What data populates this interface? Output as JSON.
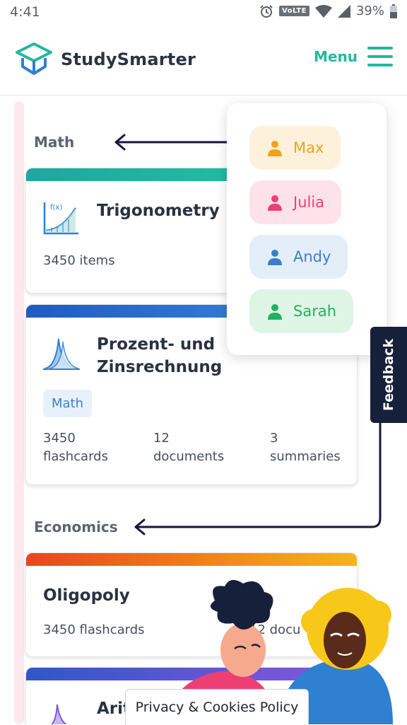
{
  "status_bar": {
    "time": "4:41",
    "volte": "VoLTE",
    "battery": "39%"
  },
  "header": {
    "brand": "StudySmarter",
    "menu_label": "Menu",
    "accent_color": "#22b8a0"
  },
  "sections": {
    "math": "Math",
    "economics": "Economics"
  },
  "cards": {
    "trigonometry": {
      "title": "Trigonometry",
      "items_count": "3450",
      "items_label": "items"
    },
    "prozent": {
      "title_line1": "Prozent- und",
      "title_line2": "Zinsrechnung",
      "tag": "Math",
      "stats": [
        {
          "value": "3450",
          "label": "flashcards"
        },
        {
          "value": "12",
          "label": "documents"
        },
        {
          "value": "3",
          "label": "summaries"
        }
      ]
    },
    "oligopoly": {
      "title": "Oligopoly",
      "flashcards_count": "3450",
      "flashcards_label": "flashcards",
      "documents_partial": "12 docu"
    },
    "arithmetic": {
      "title_partial": "Arit"
    }
  },
  "users": [
    {
      "name": "Max",
      "color": "#f0a21c",
      "bg": "#fdf1dc"
    },
    {
      "name": "Julia",
      "color": "#ee3f74",
      "bg": "#fde2ea"
    },
    {
      "name": "Andy",
      "color": "#3a7fc8",
      "bg": "#e4eef9"
    },
    {
      "name": "Sarah",
      "color": "#20b25e",
      "bg": "#def5e6"
    }
  ],
  "feedback_label": "Feedback",
  "privacy_label": "Privacy & Cookies Policy",
  "icons": [
    "alarm-icon",
    "wifi-icon",
    "signal-icon",
    "battery-icon",
    "logo-cube-icon",
    "hamburger-icon",
    "function-graph-icon",
    "bell-curve-icon",
    "user-icon",
    "arrow-left-icon"
  ]
}
